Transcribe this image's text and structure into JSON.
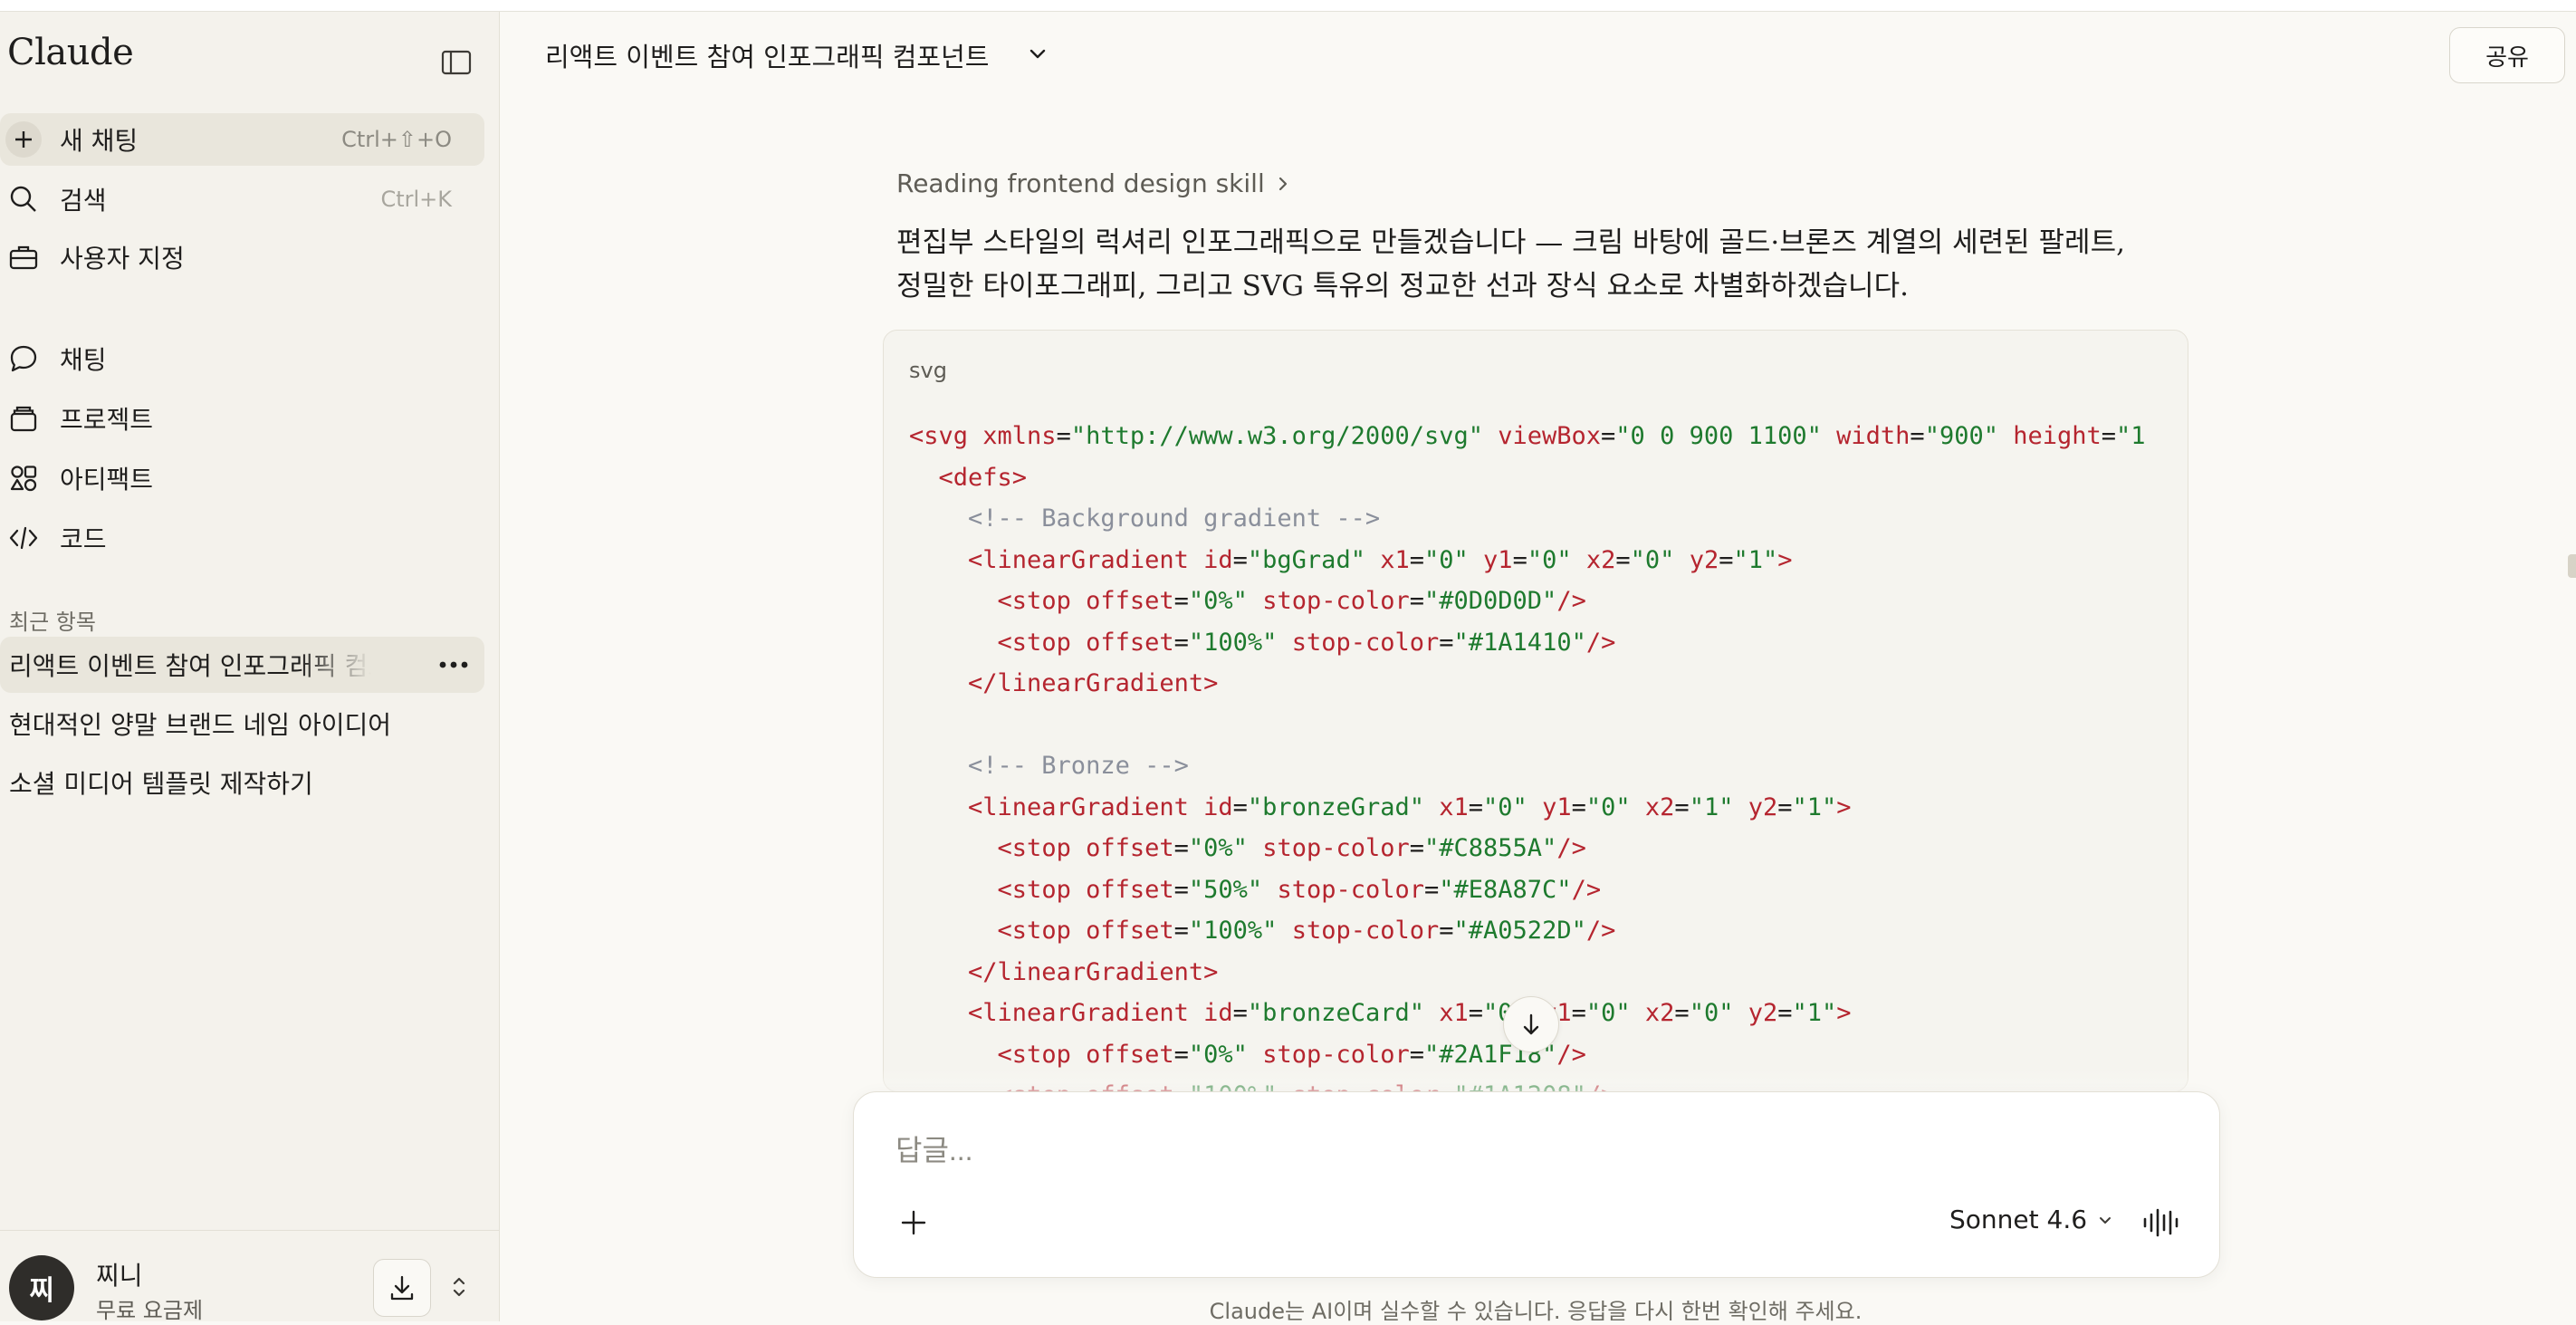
{
  "app": {
    "name": "Claude"
  },
  "sidebar": {
    "new_chat": {
      "label": "새 채팅",
      "shortcut": "Ctrl+⇧+O"
    },
    "search": {
      "label": "검색",
      "shortcut": "Ctrl+K"
    },
    "customize": {
      "label": "사용자 지정"
    },
    "nav": [
      {
        "label": "채팅",
        "icon": "chat-icon"
      },
      {
        "label": "프로젝트",
        "icon": "projects-icon"
      },
      {
        "label": "아티팩트",
        "icon": "artifacts-icon"
      },
      {
        "label": "코드",
        "icon": "code-icon"
      }
    ],
    "recent_title": "최근 항목",
    "recent": [
      {
        "label": "리액트 이벤트 참여 인포그래픽 컴포넌트"
      },
      {
        "label": "현대적인 양말 브랜드 네임 아이디어"
      },
      {
        "label": "소셜 미디어 템플릿 제작하기"
      }
    ],
    "user": {
      "initial": "찌",
      "name": "찌니",
      "plan": "무료 요금제"
    }
  },
  "header": {
    "title": "리액트 이벤트 참여 인포그래픽 컴포넌트",
    "share_label": "공유"
  },
  "message": {
    "skill_status": "Reading frontend design skill",
    "text": "편집부 스타일의 럭셔리 인포그래픽으로 만들겠습니다 — 크림 바탕에 골드·브론즈 계열의 세련된 팔레트, 정밀한 타이포그래피, 그리고 SVG 특유의 정교한 선과 장식 요소로 차별화하겠습니다.",
    "code": {
      "language": "svg",
      "lines": [
        [
          [
            "tg",
            "<svg "
          ],
          [
            "at",
            "xmlns"
          ],
          [
            "pn",
            "="
          ],
          [
            "vl",
            "\"http://www.w3.org/2000/svg\""
          ],
          [
            "at",
            " viewBox"
          ],
          [
            "pn",
            "="
          ],
          [
            "vl",
            "\"0 0 900 1100\""
          ],
          [
            "at",
            " width"
          ],
          [
            "pn",
            "="
          ],
          [
            "vl",
            "\"900\""
          ],
          [
            "at",
            " height"
          ],
          [
            "pn",
            "="
          ],
          [
            "vl",
            "\"1"
          ]
        ],
        [
          [
            "pn",
            "  "
          ],
          [
            "tg",
            "<defs>"
          ]
        ],
        [
          [
            "cm",
            "    <!-- Background gradient -->"
          ]
        ],
        [
          [
            "pn",
            "    "
          ],
          [
            "tg",
            "<linearGradient "
          ],
          [
            "at",
            "id"
          ],
          [
            "pn",
            "="
          ],
          [
            "vl",
            "\"bgGrad\""
          ],
          [
            "at",
            " x1"
          ],
          [
            "pn",
            "="
          ],
          [
            "vl",
            "\"0\""
          ],
          [
            "at",
            " y1"
          ],
          [
            "pn",
            "="
          ],
          [
            "vl",
            "\"0\""
          ],
          [
            "at",
            " x2"
          ],
          [
            "pn",
            "="
          ],
          [
            "vl",
            "\"0\""
          ],
          [
            "at",
            " y2"
          ],
          [
            "pn",
            "="
          ],
          [
            "vl",
            "\"1\""
          ],
          [
            "tg",
            ">"
          ]
        ],
        [
          [
            "pn",
            "      "
          ],
          [
            "tg",
            "<stop "
          ],
          [
            "at",
            "offset"
          ],
          [
            "pn",
            "="
          ],
          [
            "vl",
            "\"0%\""
          ],
          [
            "at",
            " stop-color"
          ],
          [
            "pn",
            "="
          ],
          [
            "vl",
            "\"#0D0D0D\""
          ],
          [
            "tg",
            "/>"
          ]
        ],
        [
          [
            "pn",
            "      "
          ],
          [
            "tg",
            "<stop "
          ],
          [
            "at",
            "offset"
          ],
          [
            "pn",
            "="
          ],
          [
            "vl",
            "\"100%\""
          ],
          [
            "at",
            " stop-color"
          ],
          [
            "pn",
            "="
          ],
          [
            "vl",
            "\"#1A1410\""
          ],
          [
            "tg",
            "/>"
          ]
        ],
        [
          [
            "pn",
            "    "
          ],
          [
            "tg",
            "</linearGradient>"
          ]
        ],
        [
          [
            "pn",
            " "
          ]
        ],
        [
          [
            "cm",
            "    <!-- Bronze -->"
          ]
        ],
        [
          [
            "pn",
            "    "
          ],
          [
            "tg",
            "<linearGradient "
          ],
          [
            "at",
            "id"
          ],
          [
            "pn",
            "="
          ],
          [
            "vl",
            "\"bronzeGrad\""
          ],
          [
            "at",
            " x1"
          ],
          [
            "pn",
            "="
          ],
          [
            "vl",
            "\"0\""
          ],
          [
            "at",
            " y1"
          ],
          [
            "pn",
            "="
          ],
          [
            "vl",
            "\"0\""
          ],
          [
            "at",
            " x2"
          ],
          [
            "pn",
            "="
          ],
          [
            "vl",
            "\"1\""
          ],
          [
            "at",
            " y2"
          ],
          [
            "pn",
            "="
          ],
          [
            "vl",
            "\"1\""
          ],
          [
            "tg",
            ">"
          ]
        ],
        [
          [
            "pn",
            "      "
          ],
          [
            "tg",
            "<stop "
          ],
          [
            "at",
            "offset"
          ],
          [
            "pn",
            "="
          ],
          [
            "vl",
            "\"0%\""
          ],
          [
            "at",
            " stop-color"
          ],
          [
            "pn",
            "="
          ],
          [
            "vl",
            "\"#C8855A\""
          ],
          [
            "tg",
            "/>"
          ]
        ],
        [
          [
            "pn",
            "      "
          ],
          [
            "tg",
            "<stop "
          ],
          [
            "at",
            "offset"
          ],
          [
            "pn",
            "="
          ],
          [
            "vl",
            "\"50%\""
          ],
          [
            "at",
            " stop-color"
          ],
          [
            "pn",
            "="
          ],
          [
            "vl",
            "\"#E8A87C\""
          ],
          [
            "tg",
            "/>"
          ]
        ],
        [
          [
            "pn",
            "      "
          ],
          [
            "tg",
            "<stop "
          ],
          [
            "at",
            "offset"
          ],
          [
            "pn",
            "="
          ],
          [
            "vl",
            "\"100%\""
          ],
          [
            "at",
            " stop-color"
          ],
          [
            "pn",
            "="
          ],
          [
            "vl",
            "\"#A0522D\""
          ],
          [
            "tg",
            "/>"
          ]
        ],
        [
          [
            "pn",
            "    "
          ],
          [
            "tg",
            "</linearGradient>"
          ]
        ],
        [
          [
            "pn",
            "    "
          ],
          [
            "tg",
            "<linearGradient "
          ],
          [
            "at",
            "id"
          ],
          [
            "pn",
            "="
          ],
          [
            "vl",
            "\"bronzeCard\""
          ],
          [
            "at",
            " x1"
          ],
          [
            "pn",
            "="
          ],
          [
            "vl",
            "\"0\""
          ],
          [
            "at",
            " y1"
          ],
          [
            "pn",
            "="
          ],
          [
            "vl",
            "\"0\""
          ],
          [
            "at",
            " x2"
          ],
          [
            "pn",
            "="
          ],
          [
            "vl",
            "\"0\""
          ],
          [
            "at",
            " y2"
          ],
          [
            "pn",
            "="
          ],
          [
            "vl",
            "\"1\""
          ],
          [
            "tg",
            ">"
          ]
        ],
        [
          [
            "pn",
            "      "
          ],
          [
            "tg",
            "<stop "
          ],
          [
            "at",
            "offset"
          ],
          [
            "pn",
            "="
          ],
          [
            "vl",
            "\"0%\""
          ],
          [
            "at",
            " stop-color"
          ],
          [
            "pn",
            "="
          ],
          [
            "vl",
            "\"#2A1F18\""
          ],
          [
            "tg",
            "/>"
          ]
        ],
        [
          [
            "pn",
            "      "
          ],
          [
            "tg",
            "<stop "
          ],
          [
            "at",
            "offset"
          ],
          [
            "pn",
            "="
          ],
          [
            "vl",
            "\"100%\""
          ],
          [
            "at",
            " stop-color"
          ],
          [
            "pn",
            "="
          ],
          [
            "vl",
            "\"#1A1208\""
          ],
          [
            "tg",
            "/>"
          ]
        ]
      ]
    }
  },
  "composer": {
    "placeholder": "답글...",
    "model": "Sonnet 4.6"
  },
  "footer": {
    "disclaimer": "Claude는 AI이며 실수할 수 있습니다. 응답을 다시 한번 확인해 주세요."
  }
}
